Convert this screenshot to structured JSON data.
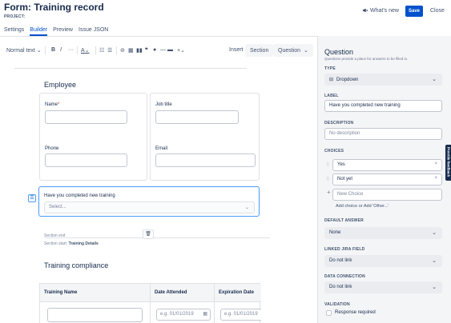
{
  "header": {
    "form_title": "Form: Training record",
    "project_label": "PROJECT:",
    "whats_new": "What's new",
    "save": "Save",
    "close": "Close"
  },
  "tabs": [
    {
      "label": "Settings"
    },
    {
      "label": "Builder",
      "active": true
    },
    {
      "label": "Preview"
    },
    {
      "label": "Issue JSON"
    }
  ],
  "toolbar": {
    "text_style": "Normal text",
    "bold": "B",
    "italic": "I",
    "more": "···",
    "text_color": "A",
    "insert_label": "Insert",
    "section_button": "Section",
    "question_button": "Question"
  },
  "editor": {
    "section1_title": "Employee",
    "fields": {
      "name_label": "Name",
      "name_required": "*",
      "job_title_label": "Job title",
      "phone_label": "Phone",
      "email_label": "Email"
    },
    "question": {
      "label": "Have you completed new training",
      "placeholder": "Select...",
      "handle_glyph": "☰"
    },
    "section_end": "Section end",
    "section_start_prefix": "Section start:",
    "section_start_name": "Training Details",
    "section2_title": "Training compliance",
    "table": {
      "headers": [
        "Training Name",
        "Date Attended",
        "Expiration Date"
      ],
      "date_placeholder": "e.g. 01/01/2019"
    }
  },
  "panel": {
    "title": "Question",
    "subtitle": "Questions provide a place for answers to be filled in.",
    "type_label": "TYPE",
    "type_value": "Dropdown",
    "label_label": "LABEL",
    "label_value": "Have you completed new training",
    "description_label": "DESCRIPTION",
    "description_placeholder": "No description",
    "choices_label": "CHOICES",
    "choices": [
      "Yes",
      "Not yet"
    ],
    "new_choice_placeholder": "New Choice",
    "add_choice": "Add choice",
    "add_choice_or": "or",
    "add_other": "Add 'Other...'",
    "default_answer_label": "DEFAULT ANSWER",
    "default_answer_value": "None",
    "linked_jira_label": "LINKED JIRA FIELD",
    "linked_jira_value": "Do not link",
    "data_connection_label": "DATA CONNECTION",
    "data_connection_value": "Do not link",
    "validation_label": "VALIDATION",
    "response_required": "Response required",
    "feedback": "Provide feedback"
  },
  "colors": {
    "primary": "#0052cc",
    "focus": "#4c9aff",
    "panel_bg": "#f4f5f7",
    "required": "#de350b"
  }
}
